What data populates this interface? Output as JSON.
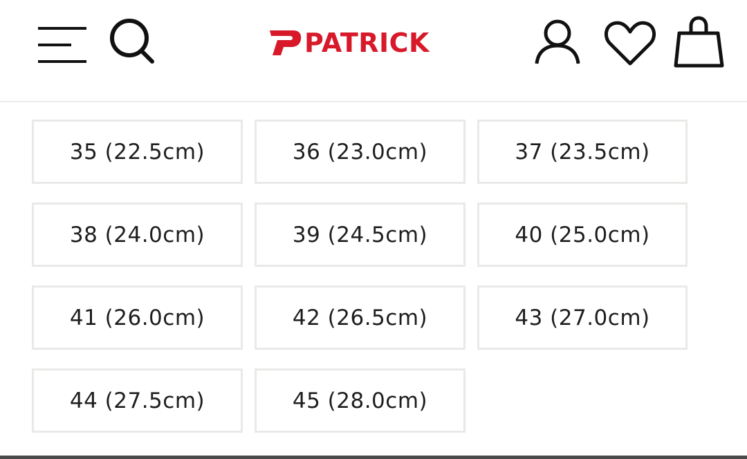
{
  "header": {
    "brand": "PATRICK",
    "brand_color": "#d7192a",
    "icons": {
      "menu": "hamburger-menu-icon",
      "search": "search-icon",
      "account": "user-icon",
      "wishlist": "heart-icon",
      "cart": "shopping-bag-icon"
    }
  },
  "sizes": [
    {
      "label": "35 (22.5cm)"
    },
    {
      "label": "36 (23.0cm)"
    },
    {
      "label": "37 (23.5cm)"
    },
    {
      "label": "38 (24.0cm)"
    },
    {
      "label": "39 (24.5cm)"
    },
    {
      "label": "40 (25.0cm)"
    },
    {
      "label": "41 (26.0cm)"
    },
    {
      "label": "42 (26.5cm)"
    },
    {
      "label": "43 (27.0cm)"
    },
    {
      "label": "44 (27.5cm)"
    },
    {
      "label": "45 (28.0cm)"
    }
  ]
}
